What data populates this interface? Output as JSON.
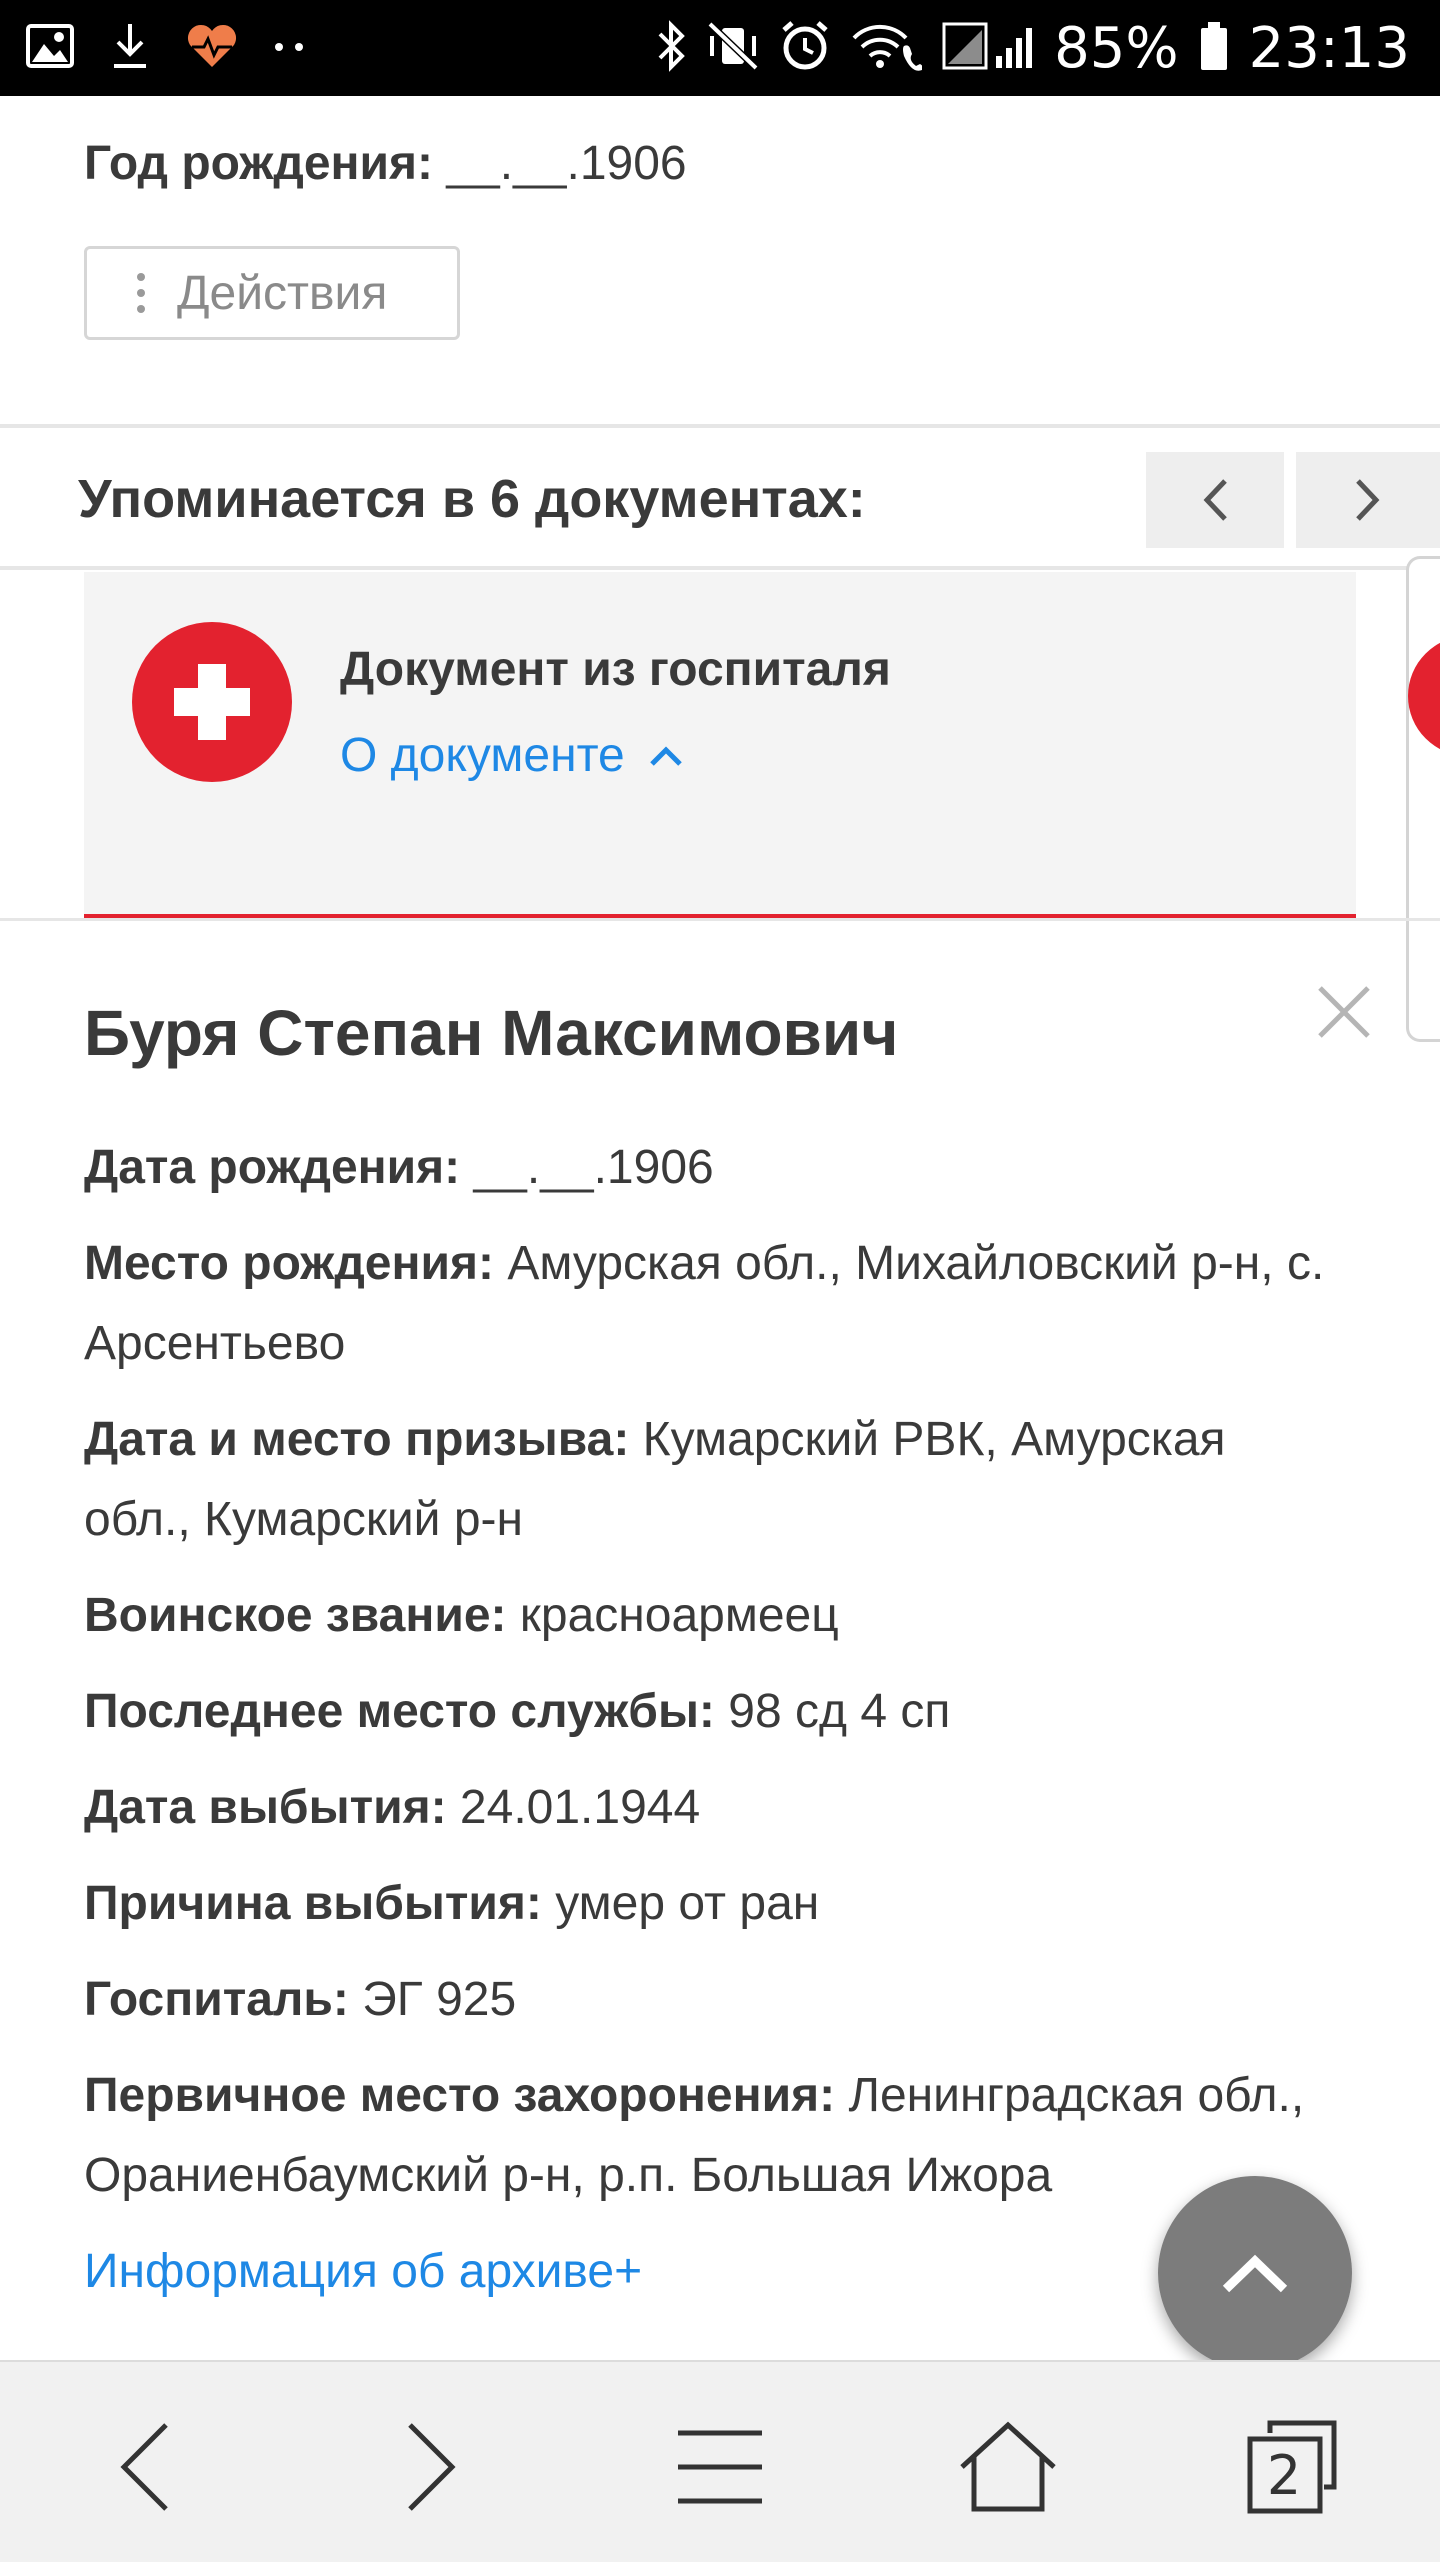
{
  "status_bar": {
    "battery": "85%",
    "time": "23:13",
    "left_icons": [
      "image-icon",
      "download-icon",
      "health-heart-icon",
      "more-dots-icon"
    ],
    "right_icons": [
      "bluetooth-icon",
      "vibrate-mute-icon",
      "alarm-icon",
      "wifi-call-icon",
      "signal-icon",
      "battery-icon"
    ]
  },
  "record_top": {
    "birth_label": "Год рождения:",
    "birth_value": "__.__.1906",
    "actions_label": "Действия"
  },
  "mentions": {
    "heading": "Упоминается в 6 документах:"
  },
  "document_card": {
    "title": "Документ из госпиталя",
    "link": "О документе"
  },
  "person": {
    "name": "Буря Степан Максимович",
    "fields": [
      {
        "label": "Дата рождения:",
        "value": "__.__.1906"
      },
      {
        "label": "Место рождения:",
        "value": "Амурская обл., Михайловский р-н, с. Арсентьево"
      },
      {
        "label": "Дата и место призыва:",
        "value": "Кумарский РВК, Амурская обл., Кумарский р-н"
      },
      {
        "label": "Воинское звание:",
        "value": "красноармеец"
      },
      {
        "label": "Последнее место службы:",
        "value": "98 сд 4 сп"
      },
      {
        "label": "Дата выбытия:",
        "value": "24.01.1944"
      },
      {
        "label": "Причина выбытия:",
        "value": "умер от ран"
      },
      {
        "label": "Госпиталь:",
        "value": "ЭГ 925"
      },
      {
        "label": "Первичное место захоронения:",
        "value": "Ленинградская обл., Ораниенбаумский р-н, р.п. Большая Ижора"
      }
    ],
    "archive_link": "Информация об архиве+"
  },
  "bottom_bar": {
    "tabs_count": "2"
  },
  "colors": {
    "accent_red": "#e3222f",
    "link_blue": "#1e88e5"
  }
}
